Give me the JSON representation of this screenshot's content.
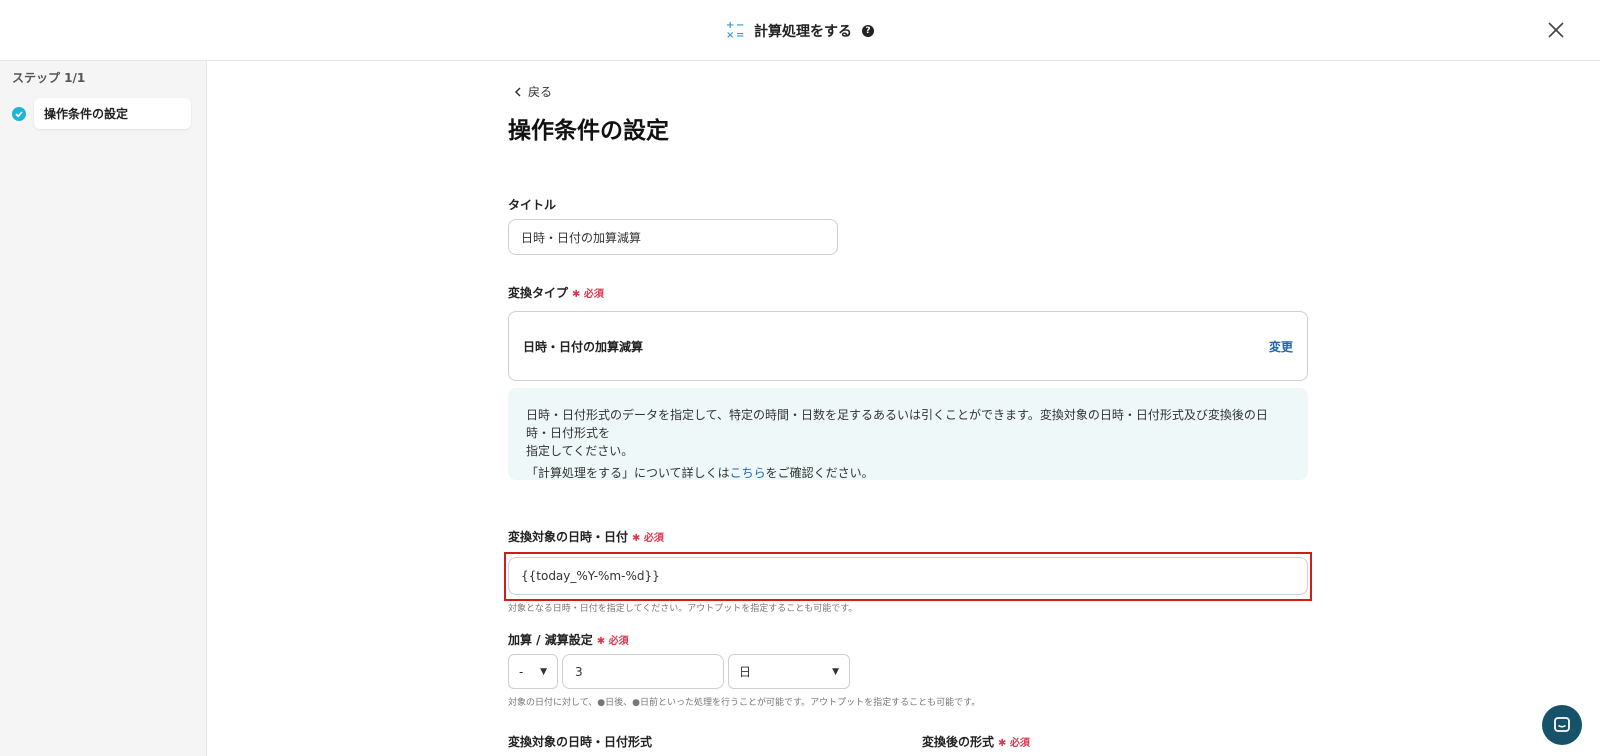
{
  "header": {
    "title": "計算処理をする",
    "help_icon": "?"
  },
  "sidebar": {
    "step_label": "ステップ 1/1",
    "steps": [
      {
        "label": "操作条件の設定"
      }
    ]
  },
  "main": {
    "back_label": "戻る",
    "page_title": "操作条件の設定",
    "title_field": {
      "label": "タイトル",
      "value": "日時・日付の加算減算"
    },
    "type_field": {
      "label": "変換タイプ",
      "required": "✱ 必須",
      "value": "日時・日付の加算減算",
      "change_label": "変更"
    },
    "info": {
      "line1": "日時・日付形式のデータを指定して、特定の時間・日数を足するあるいは引くことができます。変換対象の日時・日付形式及び変換後の日時・日付形式を",
      "line2": "指定してください。",
      "line3_prefix": "「計算処理をする」について詳しくは",
      "line3_link": "こちら",
      "line3_suffix": "をご確認ください。"
    },
    "target_field": {
      "label": "変換対象の日時・日付",
      "required": "✱ 必須",
      "value": "{{today_%Y-%m-%d}}",
      "hint": "対象となる日時・日付を指定してください。アウトプットを指定することも可能です。"
    },
    "addsub_field": {
      "label": "加算 / 減算設定",
      "required": "✱ 必須",
      "sign_value": "-",
      "amount_value": "3",
      "unit_value": "日",
      "hint": "対象の日付に対して、●日後、●日前といった処理を行うことが可能です。アウトプットを指定することも可能です。"
    },
    "bottom_labels": {
      "left": "変換対象の日時・日付形式",
      "right": "変換後の形式",
      "right_required": "✱ 必須"
    }
  },
  "colors": {
    "accent": "#1fb6d6",
    "link": "#2366a8",
    "required": "#e0364f",
    "highlight": "#d21c1c",
    "chat": "#17526b"
  }
}
